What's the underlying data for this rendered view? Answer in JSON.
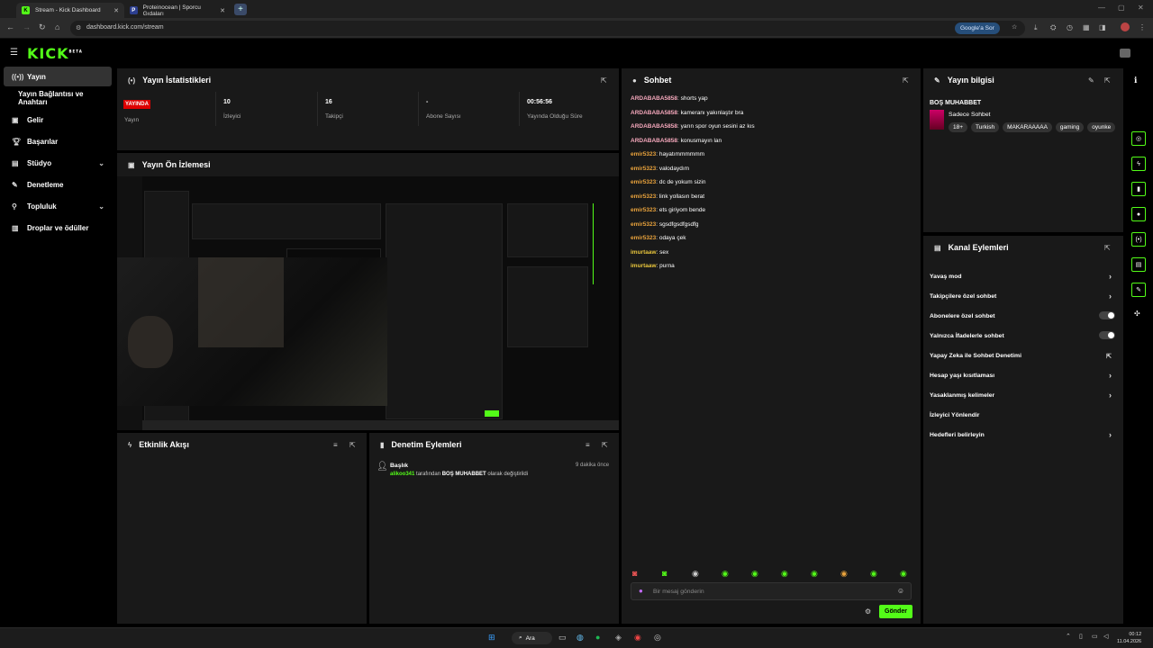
{
  "browser": {
    "tabs": [
      {
        "title": "Stream - Kick Dashboard",
        "favicon": "K"
      },
      {
        "title": "Proteinocean | Sporcu Gıdaları",
        "favicon": "P"
      }
    ],
    "url": "dashboard.kick.com/stream",
    "google_pill": "Google'a Sor"
  },
  "app": {
    "logo": "KICK",
    "logo_beta": "BETA",
    "accent": "#53fc18"
  },
  "sidebar": {
    "items": [
      {
        "label": "Yayın",
        "icon": "broadcast-icon"
      },
      {
        "label": "Yayın Bağlantısı ve Anahtarı",
        "icon": ""
      },
      {
        "label": "Gelir",
        "icon": "revenue-icon"
      },
      {
        "label": "Başarılar",
        "icon": "trophy-icon"
      },
      {
        "label": "Stüdyo",
        "icon": "studio-icon"
      },
      {
        "label": "Denetleme",
        "icon": "wrench-icon"
      },
      {
        "label": "Topluluk",
        "icon": "community-icon"
      },
      {
        "label": "Droplar ve ödüller",
        "icon": "gift-icon"
      }
    ]
  },
  "stats": {
    "title": "Yayın İstatistikleri",
    "badge": "YAYINDA",
    "items": [
      {
        "value": "",
        "label": "Yayın"
      },
      {
        "value": "10",
        "label": "İzleyici"
      },
      {
        "value": "16",
        "label": "Takipçi"
      },
      {
        "value": "-",
        "label": "Abone Sayısı"
      },
      {
        "value": "00:56:56",
        "label": "Yayında Olduğu Süre"
      }
    ]
  },
  "preview": {
    "title": "Yayın Ön İzlemesi"
  },
  "activity": {
    "title": "Etkinlik Akışı"
  },
  "moderation": {
    "title": "Denetim Eylemleri",
    "entry_title": "Başlık",
    "entry_time": "9 dakika önce",
    "entry_user": "alikoo341",
    "entry_mid": " tarafından ",
    "entry_value": "BOŞ MUHABBET",
    "entry_end": " olarak değiştirildi"
  },
  "chat": {
    "title": "Sohbet",
    "messages": [
      {
        "user": "ARDABABA5858",
        "text": "shorts yap",
        "color": "#f4a7bb"
      },
      {
        "user": "ARDABABA5858",
        "text": "kameranı yakınlaştır bra",
        "color": "#f4a7bb"
      },
      {
        "user": "ARDABABA5858",
        "text": "yarın spor oyun sesini az kıs",
        "color": "#f4a7bb"
      },
      {
        "user": "ARDABABA5858",
        "text": "konusmayın lan",
        "color": "#f4a7bb"
      },
      {
        "user": "emir5323",
        "text": "hayatımmmmmm",
        "color": "#e8a23c"
      },
      {
        "user": "emir5323",
        "text": "valodaydım",
        "color": "#e8a23c"
      },
      {
        "user": "emir5323",
        "text": "dc de yokum sizin",
        "color": "#e8a23c"
      },
      {
        "user": "emir5323",
        "text": "link yollasın berat",
        "color": "#e8a23c"
      },
      {
        "user": "emir5323",
        "text": "ets giriyom bende",
        "color": "#e8a23c"
      },
      {
        "user": "emir5323",
        "text": "sgsdfgsdfgsdfg",
        "color": "#e8a23c"
      },
      {
        "user": "emir5323",
        "text": "odaya çek",
        "color": "#e8a23c"
      },
      {
        "user": "imurtaaw",
        "text": "sex",
        "color": "#e8c53c"
      },
      {
        "user": "imurtaaw",
        "text": "purna",
        "color": "#e8c53c"
      }
    ],
    "placeholder": "Bir mesaj gönderin",
    "send_label": "Gönder"
  },
  "stream_info": {
    "title": "Yayın bilgisi",
    "stream_title": "BOŞ MUHABBET",
    "category": "Sadece Sohbet",
    "tags": [
      "18+",
      "Turkish",
      "MAKARAAAAA",
      "gaming",
      "oyunke"
    ]
  },
  "channel_actions": {
    "title": "Kanal Eylemleri",
    "items": [
      {
        "label": "Yavaş mod",
        "control": "arrow"
      },
      {
        "label": "Takipçilere özel sohbet",
        "control": "arrow"
      },
      {
        "label": "Abonelere özel sohbet",
        "control": "toggle"
      },
      {
        "label": "Yalnızca İfadelerle sohbet",
        "control": "toggle"
      },
      {
        "label": "Yapay Zeka ile Sohbet Denetimi",
        "control": "external"
      },
      {
        "label": "Hesap yaşı kısıtlaması",
        "control": "arrow"
      },
      {
        "label": "Yasaklanmış kelimeler",
        "control": "arrow"
      },
      {
        "label": "İzleyici Yönlendir",
        "control": "none"
      },
      {
        "label": "Hedefleri belirleyin",
        "control": "arrow"
      }
    ]
  },
  "taskbar": {
    "search": "Ara",
    "time": "00:12",
    "date": "11.04.2026"
  }
}
